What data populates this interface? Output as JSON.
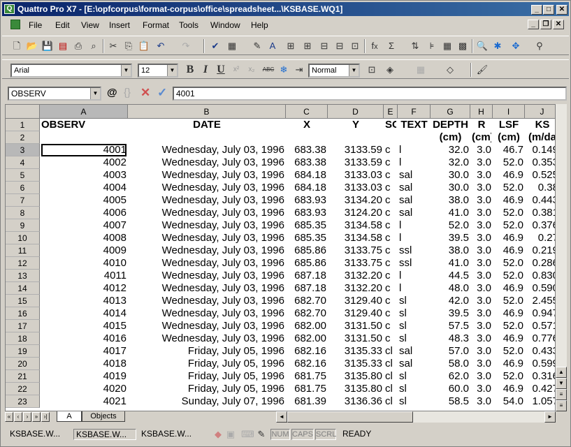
{
  "window": {
    "title": "Quattro Pro X7 - [E:\\opfcorpus\\format-corpus\\office\\spreadsheet...\\KSBASE.WQ1]",
    "minimize": "_",
    "maximize": "□",
    "close": "✕",
    "app_icon": "spreadsheet-app-icon"
  },
  "menu": [
    "File",
    "Edit",
    "View",
    "Insert",
    "Format",
    "Tools",
    "Window",
    "Help"
  ],
  "property_bar": {
    "font": "Arial",
    "size": "12",
    "bold": "B",
    "italic": "I",
    "underline": "U",
    "superscript": "x²",
    "subscript": "x₂",
    "strike": "ABC",
    "style": "Normal"
  },
  "input_line": {
    "name_box": "OBSERV",
    "at_symbol": "@",
    "braces": "{}",
    "cancel": "✕",
    "confirm": "✓",
    "contents": "4001"
  },
  "columns": [
    "A",
    "B",
    "C",
    "D",
    "E",
    "F",
    "G",
    "H",
    "I",
    "J"
  ],
  "row_numbers": [
    "1",
    "2",
    "3",
    "4",
    "5",
    "6",
    "7",
    "8",
    "9",
    "10",
    "11",
    "12",
    "13",
    "14",
    "15",
    "16",
    "17",
    "18",
    "19",
    "20",
    "21",
    "22",
    "23"
  ],
  "header_row1": [
    "OBSERV",
    "DATE",
    "X",
    "Y",
    "SC",
    "TEXT",
    "DEPTH",
    "R",
    "LSF",
    "KS"
  ],
  "header_row2": [
    "",
    "",
    "",
    "",
    "",
    "",
    "(cm)",
    "(cm)",
    "(cm)",
    "(m/da"
  ],
  "rows": [
    [
      "4001",
      "Wednesday, July 03, 1996",
      "683.38",
      "3133.59",
      "c",
      "l",
      "32.0",
      "3.0",
      "46.7",
      "0.149"
    ],
    [
      "4002",
      "Wednesday, July 03, 1996",
      "683.38",
      "3133.59",
      "c",
      "l",
      "32.0",
      "3.0",
      "52.0",
      "0.353"
    ],
    [
      "4003",
      "Wednesday, July 03, 1996",
      "684.18",
      "3133.03",
      "c",
      "sal",
      "30.0",
      "3.0",
      "46.9",
      "0.525"
    ],
    [
      "4004",
      "Wednesday, July 03, 1996",
      "684.18",
      "3133.03",
      "c",
      "sal",
      "30.0",
      "3.0",
      "52.0",
      "0.38"
    ],
    [
      "4005",
      "Wednesday, July 03, 1996",
      "683.93",
      "3134.20",
      "c",
      "sal",
      "38.0",
      "3.0",
      "46.9",
      "0.443"
    ],
    [
      "4006",
      "Wednesday, July 03, 1996",
      "683.93",
      "3124.20",
      "c",
      "sal",
      "41.0",
      "3.0",
      "52.0",
      "0.381"
    ],
    [
      "4007",
      "Wednesday, July 03, 1996",
      "685.35",
      "3134.58",
      "c",
      "l",
      "52.0",
      "3.0",
      "52.0",
      "0.376"
    ],
    [
      "4008",
      "Wednesday, July 03, 1996",
      "685.35",
      "3134.58",
      "c",
      "l",
      "39.5",
      "3.0",
      "46.9",
      "0.27"
    ],
    [
      "4009",
      "Wednesday, July 03, 1996",
      "685.86",
      "3133.75",
      "c",
      "ssl",
      "38.0",
      "3.0",
      "46.9",
      "0.219"
    ],
    [
      "4010",
      "Wednesday, July 03, 1996",
      "685.86",
      "3133.75",
      "c",
      "ssl",
      "41.0",
      "3.0",
      "52.0",
      "0.286"
    ],
    [
      "4011",
      "Wednesday, July 03, 1996",
      "687.18",
      "3132.20",
      "c",
      "l",
      "44.5",
      "3.0",
      "52.0",
      "0.830"
    ],
    [
      "4012",
      "Wednesday, July 03, 1996",
      "687.18",
      "3132.20",
      "c",
      "l",
      "48.0",
      "3.0",
      "46.9",
      "0.590"
    ],
    [
      "4013",
      "Wednesday, July 03, 1996",
      "682.70",
      "3129.40",
      "c",
      "sl",
      "42.0",
      "3.0",
      "52.0",
      "2.455"
    ],
    [
      "4014",
      "Wednesday, July 03, 1996",
      "682.70",
      "3129.40",
      "c",
      "sl",
      "39.5",
      "3.0",
      "46.9",
      "0.947"
    ],
    [
      "4015",
      "Wednesday, July 03, 1996",
      "682.00",
      "3131.50",
      "c",
      "sl",
      "57.5",
      "3.0",
      "52.0",
      "0.571"
    ],
    [
      "4016",
      "Wednesday, July 03, 1996",
      "682.00",
      "3131.50",
      "c",
      "sl",
      "48.3",
      "3.0",
      "46.9",
      "0.776"
    ],
    [
      "4017",
      "Friday, July 05, 1996",
      "682.16",
      "3135.33",
      "cl",
      "sal",
      "57.0",
      "3.0",
      "52.0",
      "0.433"
    ],
    [
      "4018",
      "Friday, July 05, 1996",
      "682.16",
      "3135.33",
      "cl",
      "sal",
      "58.0",
      "3.0",
      "46.9",
      "0.599"
    ],
    [
      "4019",
      "Friday, July 05, 1996",
      "681.75",
      "3135.80",
      "cl",
      "sl",
      "62.0",
      "3.0",
      "52.0",
      "0.316"
    ],
    [
      "4020",
      "Friday, July 05, 1996",
      "681.75",
      "3135.80",
      "cl",
      "sl",
      "60.0",
      "3.0",
      "46.9",
      "0.427"
    ],
    [
      "4021",
      "Sunday, July 07, 1996",
      "681.39",
      "3136.36",
      "cl",
      "sl",
      "58.5",
      "3.0",
      "54.0",
      "1.057"
    ]
  ],
  "sheet_tabs": [
    "A",
    "Objects"
  ],
  "status": {
    "tasks": [
      "KSBASE.W...",
      "KSBASE.W...",
      "KSBASE.W..."
    ],
    "num": "NUM",
    "caps": "CAPS",
    "scrl": "SCRL",
    "mode": "READY"
  }
}
